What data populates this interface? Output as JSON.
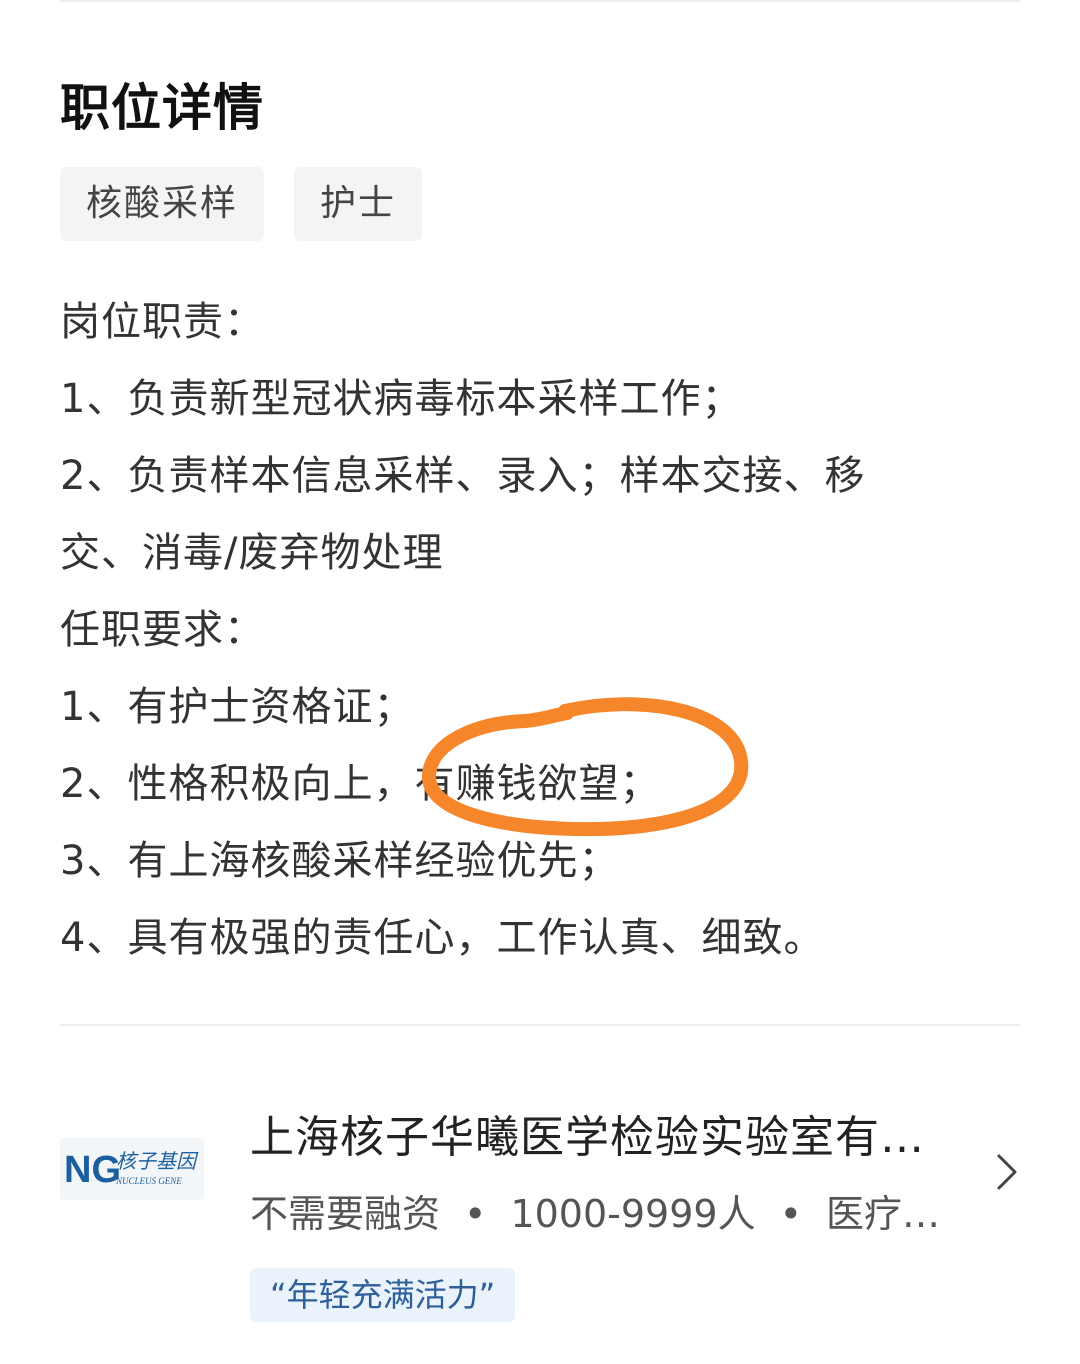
{
  "section": {
    "title": "职位详情"
  },
  "tags": [
    "核酸采样",
    "护士"
  ],
  "description": {
    "lines": [
      "岗位职责：",
      "1、负责新型冠状病毒标本采样工作；",
      "2、负责样本信息采样、录入；样本交接、移",
      "交、消毒/废弃物处理",
      "任职要求：",
      "1、有护士资格证；",
      "2、性格积极向上，有赚钱欲望；",
      "3、有上海核酸采样经验优先；",
      "4、具有极强的责任心，工作认真、细致。"
    ],
    "annotation_color": "#f5862a"
  },
  "company": {
    "logo_text_cn": "核子基因",
    "logo_text_en": "NUCLEUS GENE",
    "logo_mark": "NG",
    "name": "上海核子华曦医学检验实验室有…",
    "funding": "不需要融资",
    "size": "1000-9999人",
    "industry": "医疗…",
    "separator": "•",
    "badge": "“年轻充满活力”"
  },
  "colors": {
    "logo_blue": "#1c5f9e",
    "badge_bg": "#eaf2fb",
    "badge_text": "#2f5f9a"
  }
}
